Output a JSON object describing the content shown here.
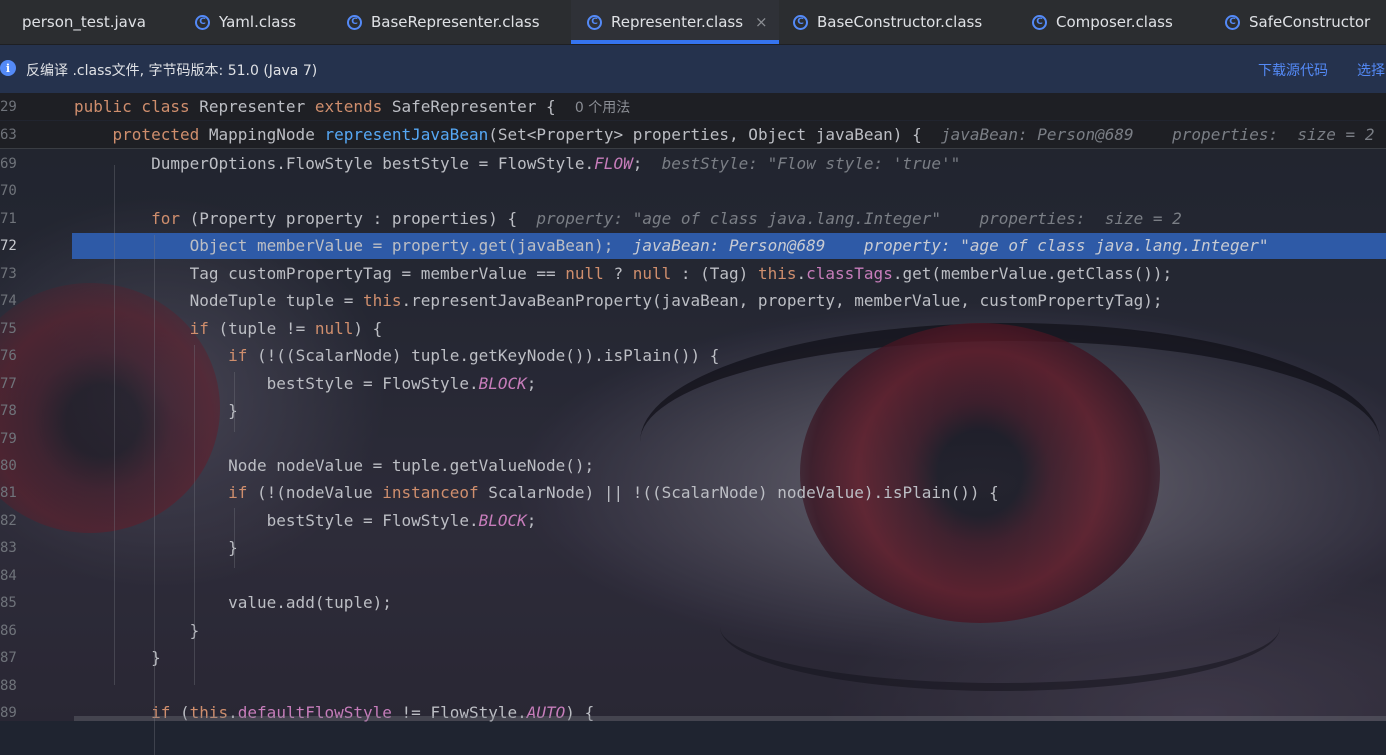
{
  "tabs": [
    {
      "label": "person_test.java",
      "icon": "java-file-icon"
    },
    {
      "label": "Yaml.class",
      "icon": "class-icon"
    },
    {
      "label": "BaseRepresenter.class",
      "icon": "class-icon"
    },
    {
      "label": "Representer.class",
      "icon": "class-icon",
      "active": true,
      "close": "×"
    },
    {
      "label": "BaseConstructor.class",
      "icon": "class-icon"
    },
    {
      "label": "Composer.class",
      "icon": "class-icon"
    },
    {
      "label": "SafeConstructor",
      "icon": "class-icon"
    }
  ],
  "tab_icon_glyph": "C",
  "banner": {
    "info_glyph": "i",
    "text": "反编译 .class文件, 字节码版本: 51.0 (Java 7)",
    "download_link": "下载源代码",
    "choose_link": "选择"
  },
  "sticky": [
    {
      "num": "29",
      "parts": [
        {
          "t": "public class ",
          "c": "kw"
        },
        {
          "t": "Representer ",
          "c": ""
        },
        {
          "t": "extends ",
          "c": "kw"
        },
        {
          "t": "SafeRepresenter {  ",
          "c": ""
        },
        {
          "t": "0 个用法",
          "c": "inlay"
        }
      ]
    },
    {
      "num": "63",
      "parts": [
        {
          "t": "    protected ",
          "c": "kw"
        },
        {
          "t": "MappingNode ",
          "c": ""
        },
        {
          "t": "representJavaBean",
          "c": "fn"
        },
        {
          "t": "(Set<Property> properties, Object javaBean) {  ",
          "c": ""
        },
        {
          "t": "javaBean: Person@689    properties:  size = 2",
          "c": "hint"
        }
      ]
    }
  ],
  "lines": [
    {
      "num": "69",
      "parts": [
        {
          "t": "        DumperOptions.FlowStyle bestStyle = FlowStyle.",
          "c": ""
        },
        {
          "t": "FLOW",
          "c": "st"
        },
        {
          "t": ";  ",
          "c": ""
        },
        {
          "t": "bestStyle: \"Flow style: 'true'\"",
          "c": "hint"
        }
      ]
    },
    {
      "num": "70",
      "parts": []
    },
    {
      "num": "71",
      "parts": [
        {
          "t": "        for ",
          "c": "kw"
        },
        {
          "t": "(Property property : properties) {  ",
          "c": ""
        },
        {
          "t": "property: \"age of class java.lang.Integer\"    properties:  size = 2",
          "c": "hint"
        }
      ]
    },
    {
      "num": "72",
      "exec": true,
      "parts": [
        {
          "t": "            Object memberValue = property.get(javaBean);  ",
          "c": ""
        },
        {
          "t": "javaBean: Person@689    property: \"age of class java.lang.Integer\"",
          "c": "exec-line-hint"
        }
      ]
    },
    {
      "num": "73",
      "parts": [
        {
          "t": "            Tag customPropertyTag = memberValue == ",
          "c": ""
        },
        {
          "t": "null",
          "c": "kw"
        },
        {
          "t": " ? ",
          "c": ""
        },
        {
          "t": "null",
          "c": "kw"
        },
        {
          "t": " : (Tag) ",
          "c": ""
        },
        {
          "t": "this",
          "c": "kw"
        },
        {
          "t": ".",
          "c": ""
        },
        {
          "t": "classTags",
          "c": "fld"
        },
        {
          "t": ".get(memberValue.getClass());",
          "c": ""
        }
      ]
    },
    {
      "num": "74",
      "parts": [
        {
          "t": "            NodeTuple tuple = ",
          "c": ""
        },
        {
          "t": "this",
          "c": "kw"
        },
        {
          "t": ".representJavaBeanProperty(javaBean, property, memberValue, customPropertyTag);",
          "c": ""
        }
      ]
    },
    {
      "num": "75",
      "parts": [
        {
          "t": "            if ",
          "c": "kw"
        },
        {
          "t": "(tuple != ",
          "c": ""
        },
        {
          "t": "null",
          "c": "kw"
        },
        {
          "t": ") {",
          "c": ""
        }
      ]
    },
    {
      "num": "76",
      "parts": [
        {
          "t": "                if ",
          "c": "kw"
        },
        {
          "t": "(!((ScalarNode) tuple.getKeyNode()).isPlain()) {",
          "c": ""
        }
      ]
    },
    {
      "num": "77",
      "parts": [
        {
          "t": "                    bestStyle = FlowStyle.",
          "c": ""
        },
        {
          "t": "BLOCK",
          "c": "st"
        },
        {
          "t": ";",
          "c": ""
        }
      ]
    },
    {
      "num": "78",
      "parts": [
        {
          "t": "                }",
          "c": ""
        }
      ]
    },
    {
      "num": "79",
      "parts": []
    },
    {
      "num": "80",
      "parts": [
        {
          "t": "                Node nodeValue = tuple.getValueNode();",
          "c": ""
        }
      ]
    },
    {
      "num": "81",
      "parts": [
        {
          "t": "                if ",
          "c": "kw"
        },
        {
          "t": "(!(nodeValue ",
          "c": ""
        },
        {
          "t": "instanceof ",
          "c": "kw"
        },
        {
          "t": "ScalarNode) || !((ScalarNode) nodeValue).isPlain()) {",
          "c": ""
        }
      ]
    },
    {
      "num": "82",
      "parts": [
        {
          "t": "                    bestStyle = FlowStyle.",
          "c": ""
        },
        {
          "t": "BLOCK",
          "c": "st"
        },
        {
          "t": ";",
          "c": ""
        }
      ]
    },
    {
      "num": "83",
      "parts": [
        {
          "t": "                }",
          "c": ""
        }
      ]
    },
    {
      "num": "84",
      "parts": []
    },
    {
      "num": "85",
      "parts": [
        {
          "t": "                value.add(tuple);",
          "c": ""
        }
      ]
    },
    {
      "num": "86",
      "parts": [
        {
          "t": "            }",
          "c": ""
        }
      ]
    },
    {
      "num": "87",
      "parts": [
        {
          "t": "        }",
          "c": ""
        }
      ]
    },
    {
      "num": "88",
      "parts": []
    },
    {
      "num": "89",
      "parts": [
        {
          "t": "        if ",
          "c": "kw"
        },
        {
          "t": "(",
          "c": ""
        },
        {
          "t": "this",
          "c": "kw"
        },
        {
          "t": ".",
          "c": ""
        },
        {
          "t": "defaultFlowStyle",
          "c": "fld"
        },
        {
          "t": " != FlowStyle.",
          "c": ""
        },
        {
          "t": "AUTO",
          "c": "st"
        },
        {
          "t": ") {",
          "c": ""
        }
      ]
    }
  ]
}
